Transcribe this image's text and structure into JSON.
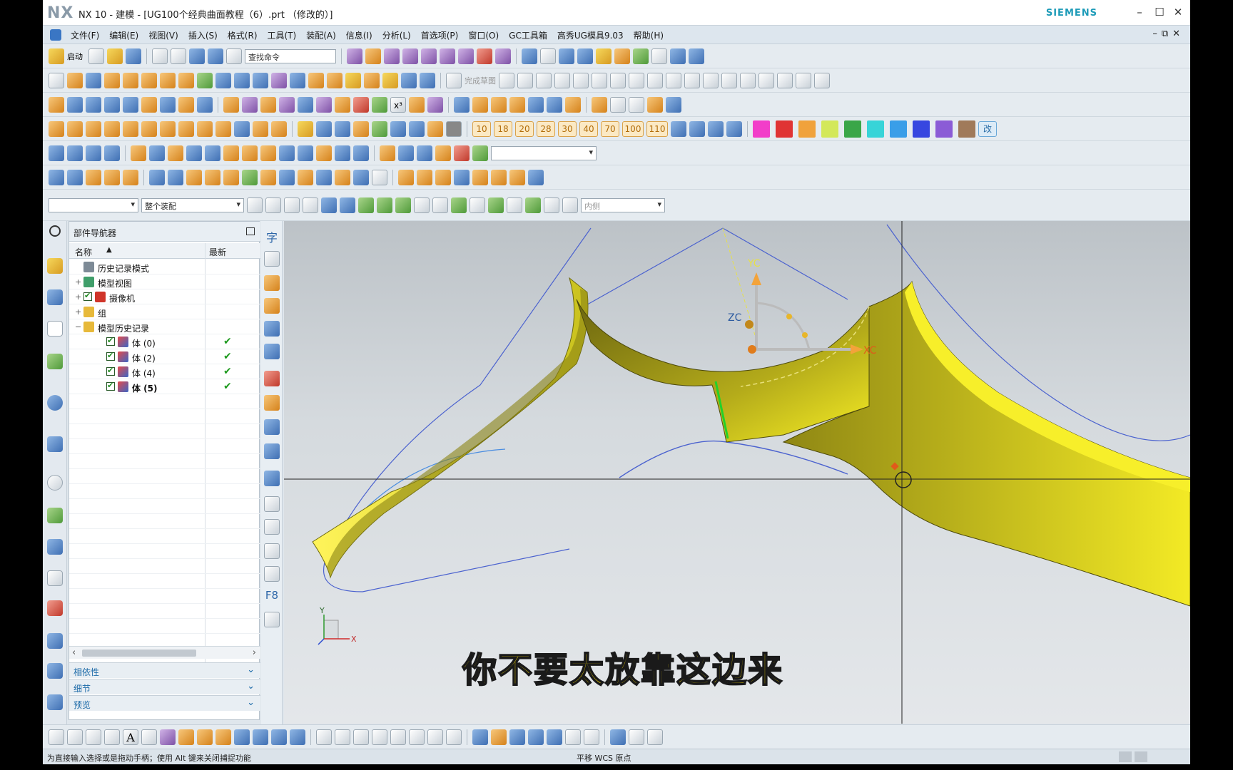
{
  "window": {
    "app_logo": "NX",
    "title": "NX 10 - 建模 - [UG100个经典曲面教程（6）.prt  （修改的）]",
    "brand": "SIEMENS"
  },
  "menu": {
    "items": [
      "文件(F)",
      "编辑(E)",
      "视图(V)",
      "插入(S)",
      "格式(R)",
      "工具(T)",
      "装配(A)",
      "信息(I)",
      "分析(L)",
      "首选项(P)",
      "窗口(O)",
      "GC工具箱",
      "高秀UG模具9.03",
      "帮助(H)"
    ]
  },
  "toolbar": {
    "start_label": "启动",
    "search_placeholder": "查找命令",
    "sketch_finish_label": "完成草图",
    "num_buttons": [
      "10",
      "18",
      "20",
      "28",
      "30",
      "40",
      "70",
      "100",
      "110"
    ],
    "change_label": "改",
    "filter_placeholder": "",
    "assembly_scope": "整个装配",
    "inner_scope": "内侧"
  },
  "colors": {
    "swatches": [
      "#f23ec9",
      "#e03434",
      "#f0a23c",
      "#d3e85a",
      "#3aa648",
      "#37d4d8",
      "#3a9ee8",
      "#3747e0",
      "#8b5cd6",
      "#a07a5a"
    ],
    "accent": "#1d9bb8",
    "surface": "#f2ea14"
  },
  "navigator": {
    "title": "部件导航器",
    "col_name": "名称",
    "col_latest": "最新",
    "nodes": [
      {
        "label": "历史记录模式",
        "level": 0
      },
      {
        "label": "模型视图",
        "level": 0
      },
      {
        "label": "摄像机",
        "level": 0
      },
      {
        "label": "组",
        "level": 0
      },
      {
        "label": "模型历史记录",
        "level": 0
      },
      {
        "label": "体 (0)",
        "level": 1
      },
      {
        "label": "体 (2)",
        "level": 1
      },
      {
        "label": "体 (4)",
        "level": 1
      },
      {
        "label": "体 (5)",
        "level": 1
      }
    ],
    "panels": [
      "相依性",
      "细节",
      "预览"
    ]
  },
  "viewport": {
    "axis_yc": "YC",
    "axis_zc": "ZC",
    "axis_xc": "XC",
    "triad_y": "Y",
    "triad_x": "X",
    "subtitle": "你不要太放靠这边来"
  },
  "selection_bar": {
    "text_icon_a": "字",
    "text_icon_f8": "F8"
  },
  "status": {
    "prompt": "为直接输入选择或是拖动手柄；使用 Alt 键来关闭捕捉功能",
    "action": "平移 WCS 原点"
  }
}
